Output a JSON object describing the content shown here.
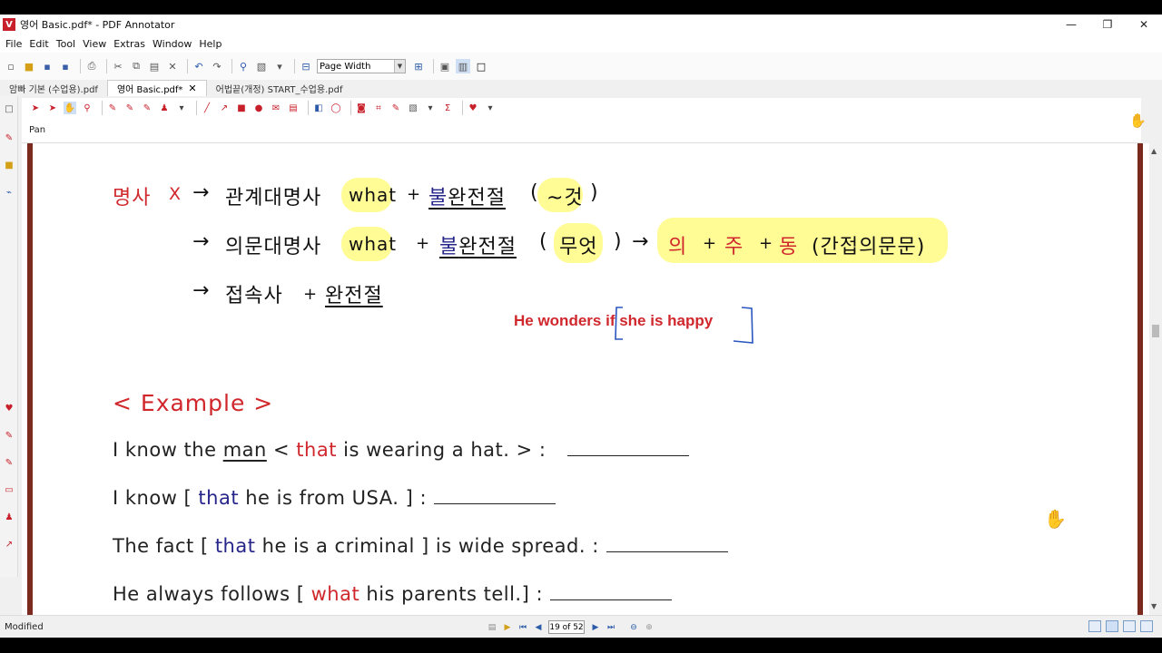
{
  "window": {
    "title": "영어 Basic.pdf* - PDF Annotator",
    "controls": {
      "minimize": "—",
      "maximize": "❐",
      "close": "✕"
    }
  },
  "menu": [
    "File",
    "Edit",
    "Tool",
    "View",
    "Extras",
    "Window",
    "Help"
  ],
  "toolbar": {
    "zoom_value": "Page Width"
  },
  "tabs": [
    {
      "label": "암빠 기본 (수업용).pdf",
      "active": false
    },
    {
      "label": "영어 Basic.pdf*",
      "active": true
    },
    {
      "label": "어법끝(개정) START_수업용.pdf",
      "active": false
    }
  ],
  "tab_close": "✕",
  "property_bar": {
    "tool": "Pan"
  },
  "document": {
    "row1": {
      "noun": "명사",
      "x_mark": "X",
      "arrow": "→",
      "term": "관계대명사",
      "what": "what",
      "plus": "+",
      "bul": "불",
      "wanjeonjeol": "완전절",
      "paren_open": "(",
      "meaning": "~것",
      "paren_close": ")"
    },
    "row2": {
      "arrow": "→",
      "term": "의문대명사",
      "what": "what",
      "plus": "+",
      "bul": "불",
      "wanjeonjeol": "완전절",
      "paren_open": "(",
      "meaning": "무엇",
      "paren_close": ")",
      "arrow2": "→",
      "ui": "의",
      "ju": "주",
      "dong": "동",
      "indirect": "(간접의문문)"
    },
    "row3": {
      "arrow": "→",
      "term": "접속사",
      "plus": "+",
      "wanjeonjeol": "완전절"
    },
    "annotation": {
      "he_wonders": "He wonders ",
      "if_clause": "if she is happy"
    },
    "example_heading": "< Example >",
    "examples": [
      {
        "pre": "I know the ",
        "man": "man",
        "mid": " < ",
        "key": "that",
        "post": " is wearing a hat. > :"
      },
      {
        "pre": "I know [ ",
        "key": "that",
        "post": " he is from USA. ] :"
      },
      {
        "pre": "The fact [ ",
        "key": "that",
        "post": " he is a criminal ] is wide spread. :"
      },
      {
        "pre": "He always follows [ ",
        "key": "what",
        "post": " his parents tell.] :"
      }
    ]
  },
  "status": {
    "text": "Modified",
    "page_indicator": "19 of 52"
  },
  "colors": {
    "accent_red": "#d0272c",
    "highlight_yellow": "#fffb8f",
    "dark_blue": "#26258a",
    "page_edge": "#7a2b1d"
  }
}
